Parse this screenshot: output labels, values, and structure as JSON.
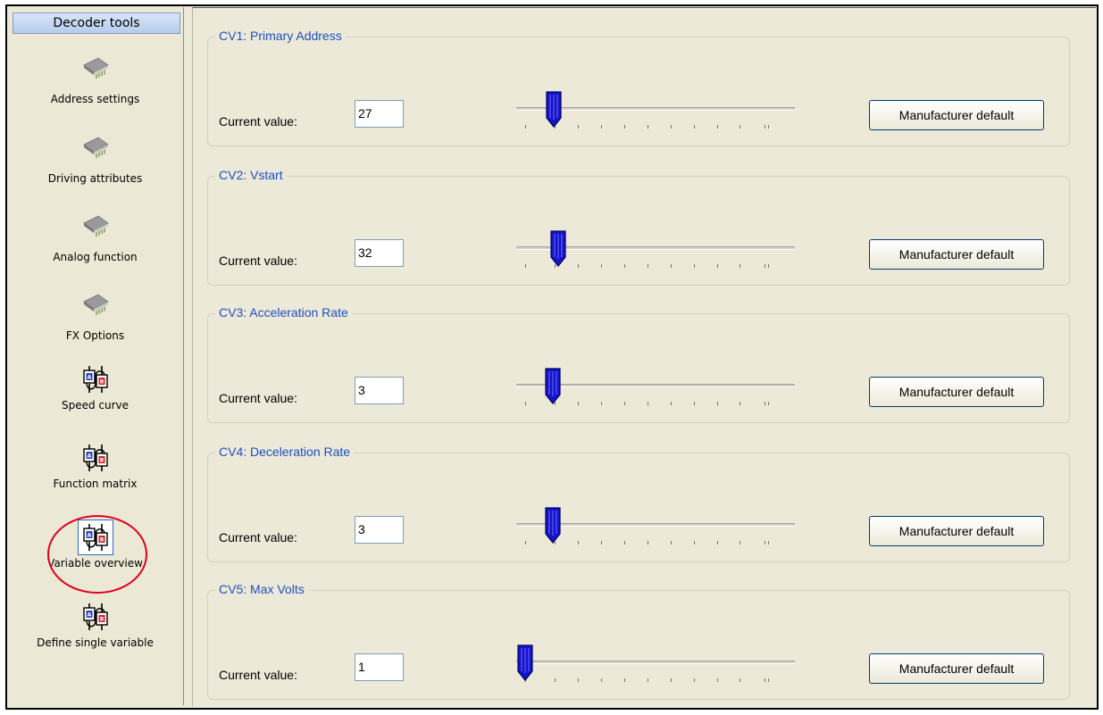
{
  "sidebar": {
    "title": "Decoder tools",
    "items": [
      {
        "label": "Address settings",
        "icon": "chip-icon"
      },
      {
        "label": "Driving attributes",
        "icon": "chip-icon"
      },
      {
        "label": "Analog function",
        "icon": "chip-icon"
      },
      {
        "label": "FX Options",
        "icon": "chip-icon"
      },
      {
        "label": "Speed curve",
        "icon": "connector-ab-icon"
      },
      {
        "label": "Function matrix",
        "icon": "connector-ab-icon"
      },
      {
        "label": "Variable overview",
        "icon": "connector-ab-icon",
        "selected": true
      },
      {
        "label": "Define single variable",
        "icon": "connector-ab-icon"
      }
    ]
  },
  "cv_groups": [
    {
      "title": "CV1: Primary Address",
      "value_label": "Current value:",
      "value": "27",
      "slider_fraction": 0.11,
      "default_label": "Manufacturer default"
    },
    {
      "title": "CV2: Vstart",
      "value_label": "Current value:",
      "value": "32",
      "slider_fraction": 0.125,
      "default_label": "Manufacturer default"
    },
    {
      "title": "CV3: Acceleration Rate",
      "value_label": "Current value:",
      "value": "3",
      "slider_fraction": 0.105,
      "default_label": "Manufacturer default"
    },
    {
      "title": "CV4: Deceleration Rate",
      "value_label": "Current value:",
      "value": "3",
      "slider_fraction": 0.105,
      "default_label": "Manufacturer default"
    },
    {
      "title": "CV5: Max Volts",
      "value_label": "Current value:",
      "value": "1",
      "slider_fraction": 0.0,
      "default_label": "Manufacturer default"
    }
  ],
  "colors": {
    "group_title": "#1d4fc4",
    "thumb": "#1414c8",
    "highlight_circle": "#e0001b"
  }
}
